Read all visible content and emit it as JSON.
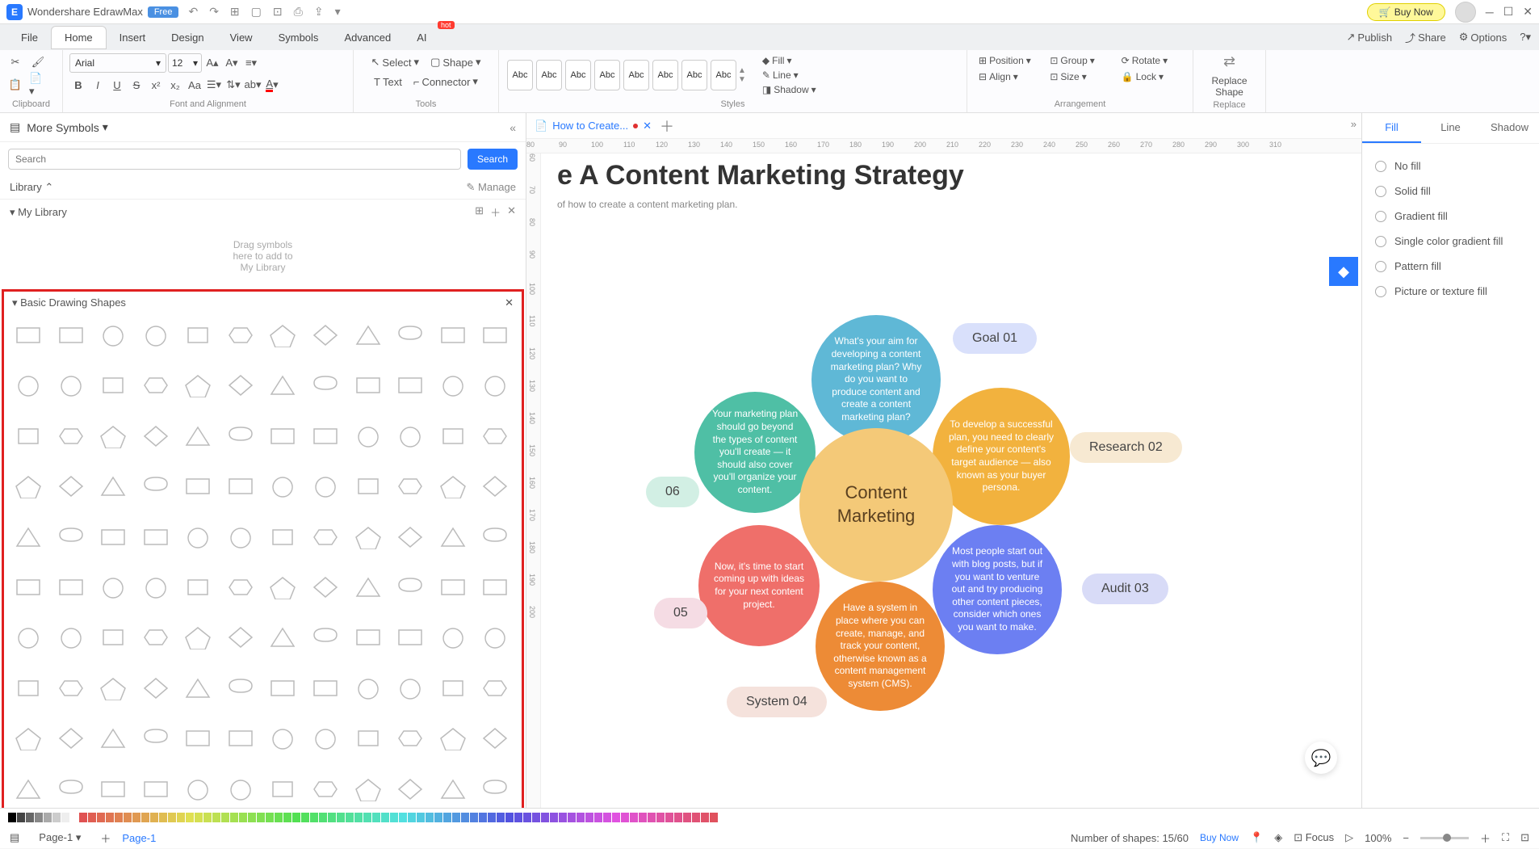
{
  "titlebar": {
    "app": "Wondershare EdrawMax",
    "free": "Free",
    "buynow": "Buy Now"
  },
  "menu": {
    "tabs": [
      "File",
      "Home",
      "Insert",
      "Design",
      "View",
      "Symbols",
      "Advanced",
      "AI"
    ],
    "active": 1,
    "hot": "hot",
    "publish": "Publish",
    "share": "Share",
    "options": "Options"
  },
  "ribbon": {
    "clipboard": "Clipboard",
    "font": {
      "name": "Arial",
      "size": "12",
      "label": "Font and Alignment"
    },
    "tools": {
      "select": "Select",
      "shape": "Shape",
      "text": "Text",
      "connector": "Connector",
      "label": "Tools"
    },
    "styles": {
      "abc": "Abc",
      "fill": "Fill",
      "line": "Line",
      "shadow": "Shadow",
      "label": "Styles"
    },
    "arrangement": {
      "position": "Position",
      "group": "Group",
      "rotate": "Rotate",
      "align": "Align",
      "size": "Size",
      "lock": "Lock",
      "label": "Arrangement"
    },
    "replace": {
      "btn": "Replace Shape",
      "label": "Replace"
    }
  },
  "left": {
    "more": "More Symbols",
    "search_ph": "Search",
    "search_btn": "Search",
    "library": "Library",
    "manage": "Manage",
    "mylib": "My Library",
    "dropzone": "Drag symbols\nhere to add to\nMy Library",
    "shapes_header": "Basic Drawing Shapes"
  },
  "canvas": {
    "tab": "How to Create...",
    "title": "e A Content Marketing Strategy",
    "subtitle": "of how to create a content marketing plan.",
    "ruler": [
      80,
      90,
      100,
      110,
      120,
      130,
      140,
      150,
      160,
      170,
      180,
      190,
      200,
      210,
      220,
      230,
      240,
      250,
      260,
      270,
      280,
      290,
      300,
      310
    ],
    "rulerv": [
      60,
      70,
      80,
      90,
      100,
      110,
      120,
      130,
      140,
      150,
      160,
      170,
      180,
      190,
      200
    ],
    "center": "Content Marketing",
    "b1": "What's your aim for developing a content marketing plan? Why do you want to produce content and create a content marketing plan?",
    "b2": "Your marketing plan should go beyond the types of content you'll create — it should also cover you'll organize your content.",
    "b3": "To develop a successful plan, you need to clearly define your content's target audience — also known as your buyer persona.",
    "b4": "Most people start out with blog posts, but if you want to venture out and try producing other content pieces, consider which ones you want to make.",
    "b5": "Now, it's time to start coming up with ideas for your next content project.",
    "b6": "Have a system in place where you can create, manage, and track your content, otherwise known as a content management system (CMS).",
    "tags": {
      "t1": "Goal 01",
      "t2": "Research 02",
      "t3": "Audit 03",
      "t4": "System 04",
      "t5": "05",
      "t6": "06"
    }
  },
  "right": {
    "tabs": [
      "Fill",
      "Line",
      "Shadow"
    ],
    "active": 0,
    "opts": [
      "No fill",
      "Solid fill",
      "Gradient fill",
      "Single color gradient fill",
      "Pattern fill",
      "Picture or texture fill"
    ]
  },
  "footer": {
    "page": "Page-1",
    "page2": "Page-1",
    "shapes": "Number of shapes: 15/60",
    "buynow": "Buy Now",
    "focus": "Focus",
    "zoom": "100%"
  }
}
